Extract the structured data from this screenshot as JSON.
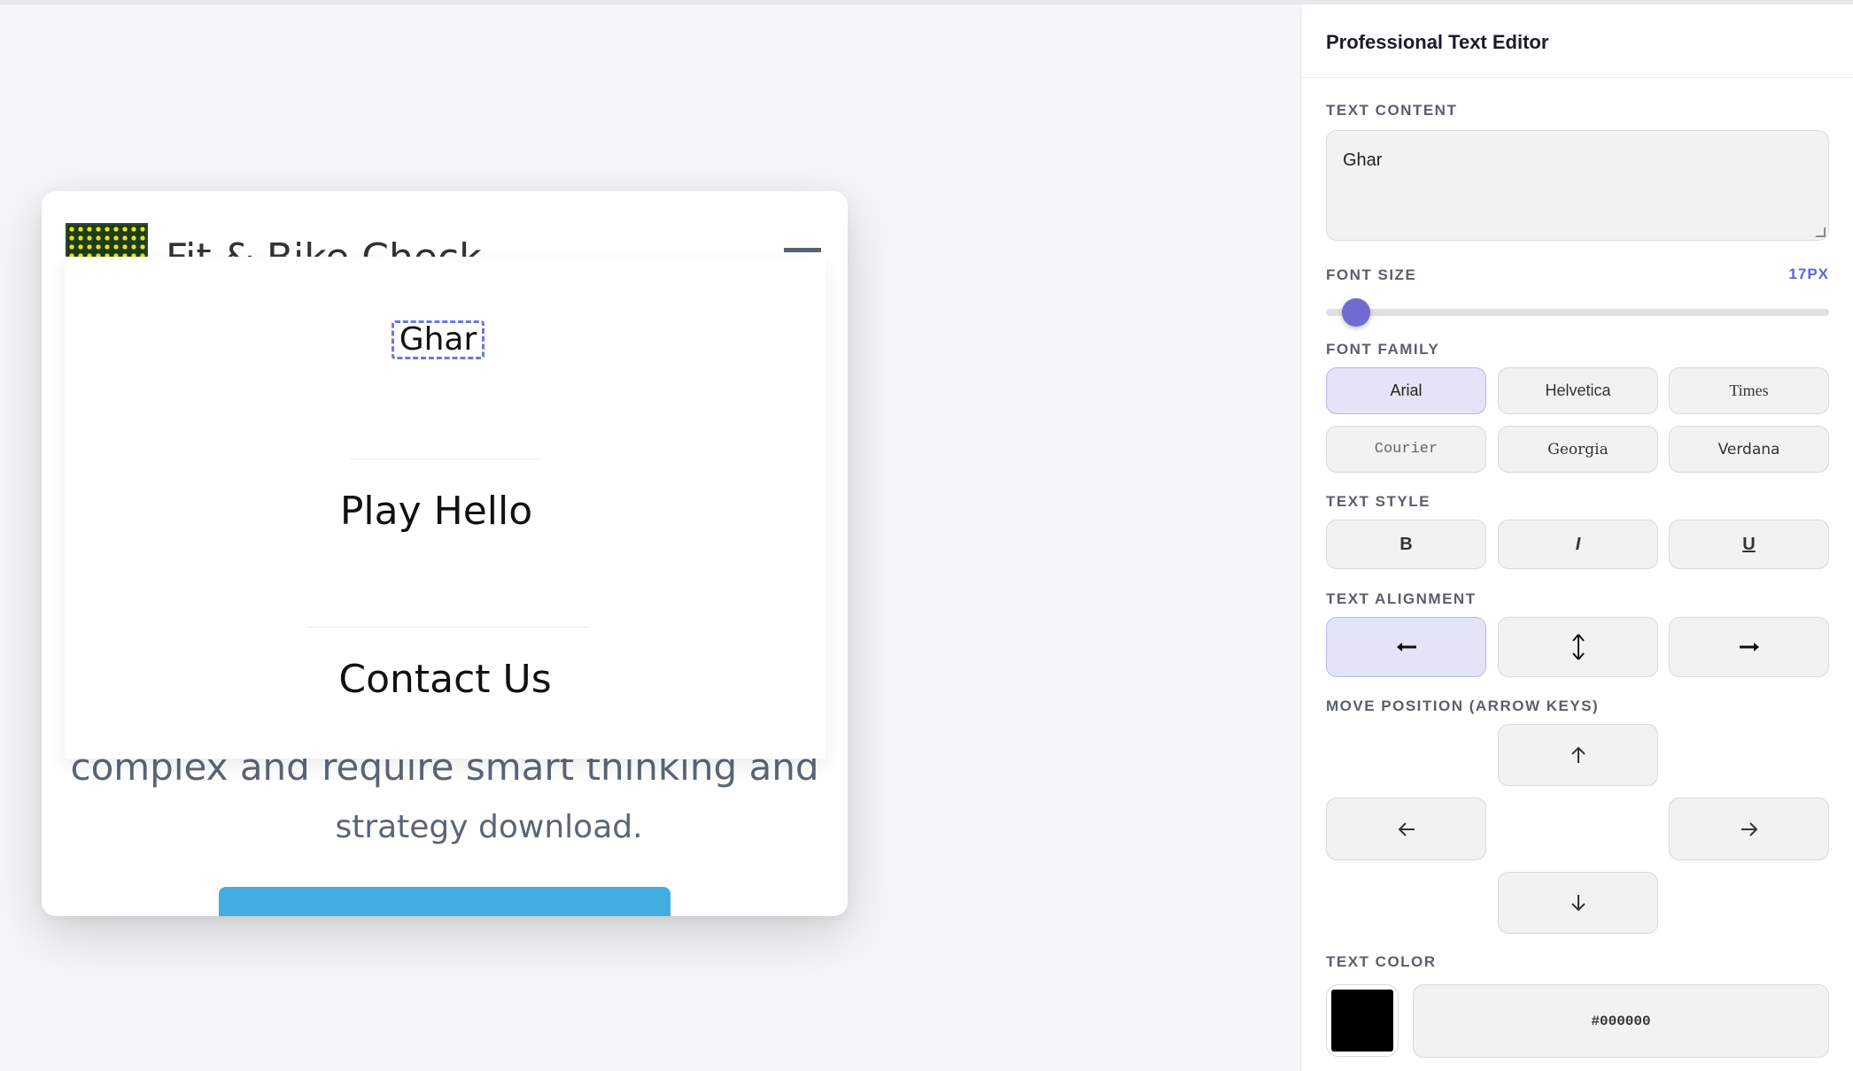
{
  "preview": {
    "site_title": "Fit & Bike Check",
    "menu": {
      "items": [
        "Ghar",
        "Play Hello",
        "Contact Us"
      ]
    },
    "body_line_1": "complex and require smart thinking and",
    "body_line_2": "strategy download."
  },
  "editor": {
    "title": "Professional Text Editor",
    "text_content_label": "TEXT CONTENT",
    "text_content_value": "Ghar",
    "font_size_label": "FONT SIZE",
    "font_size_value": "17PX",
    "font_size_slider_fraction": 0.06,
    "font_family_label": "FONT FAMILY",
    "font_families": [
      "Arial",
      "Helvetica",
      "Times",
      "Courier",
      "Georgia",
      "Verdana"
    ],
    "selected_font_family": "Arial",
    "text_style_label": "TEXT STYLE",
    "text_styles": [
      "B",
      "I",
      "U"
    ],
    "text_alignment_label": "TEXT ALIGNMENT",
    "move_position_label": "MOVE POSITION (ARROW KEYS)",
    "text_color_label": "TEXT COLOR",
    "text_color_value": "#000000"
  },
  "colors": {
    "accent": "#6f6bd0",
    "active_button_bg": "#e4e4f8",
    "cta_button": "#42aee0"
  }
}
